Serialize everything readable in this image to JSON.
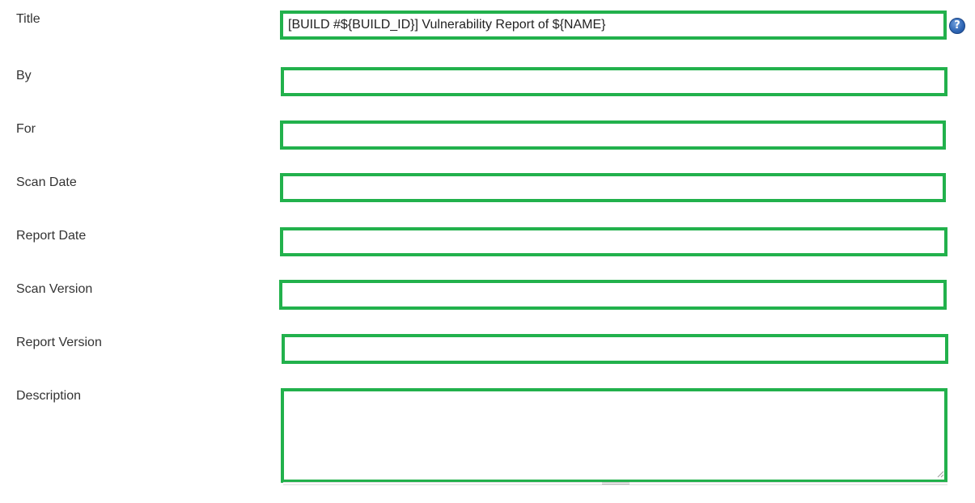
{
  "form": {
    "fields": [
      {
        "label": "Title",
        "value": "[BUILD #${BUILD_ID}] Vulnerability Report of ${NAME}"
      },
      {
        "label": "By",
        "value": ""
      },
      {
        "label": "For",
        "value": ""
      },
      {
        "label": "Scan Date",
        "value": ""
      },
      {
        "label": "Report Date",
        "value": ""
      },
      {
        "label": "Scan Version",
        "value": ""
      },
      {
        "label": "Report Version",
        "value": ""
      },
      {
        "label": "Description",
        "value": ""
      }
    ],
    "help_icon": {
      "icon": "question-help-icon",
      "glyph": "?"
    }
  },
  "colors": {
    "field_border": "#22b14c",
    "label_text": "#333333",
    "help_icon": "#2d64b3"
  }
}
